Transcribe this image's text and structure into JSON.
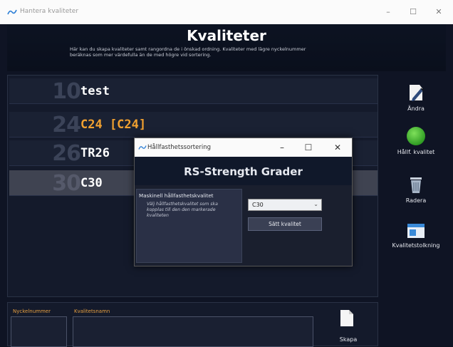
{
  "window": {
    "title": "Hantera kvaliteter",
    "controls": {
      "minimize": "–",
      "maximize": "☐",
      "close": "✕"
    }
  },
  "header": {
    "title": "Kvaliteter",
    "description": "Här kan du skapa kvaliteter samt rangordna de i önskad ordning. Kvaliteter med lägre nyckelnummer beräknas som mer värdefulla än de med högre vid sortering."
  },
  "quality_list": [
    {
      "number": "10",
      "name": "test",
      "color": "#ffffff",
      "selected": false
    },
    {
      "number": "24",
      "name": "C24 [C24]",
      "color": "#f0a030",
      "selected": false
    },
    {
      "number": "26",
      "name": "TR26",
      "color": "#ffffff",
      "selected": false
    },
    {
      "number": "30",
      "name": "C30",
      "color": "#ffffff",
      "selected": true
    }
  ],
  "sidebar": {
    "edit_label": "Ändra",
    "strength_label": "Hållf. kvalitet",
    "delete_label": "Radera",
    "interpretation_label": "Kvalitetstolkning"
  },
  "form": {
    "key_label": "Nyckelnummer",
    "name_label": "Kvalitetsnamn",
    "create_label": "Skapa"
  },
  "dialog": {
    "title": "Hållfasthetssortering",
    "header": "RS-Strength Grader",
    "section_title": "Maskinell hållfasthetskvalitet",
    "section_desc": "Välj hållfasthetskvalitet som ska kopplas till den den markerade kvaliteten",
    "selected_value": "C30",
    "button_label": "Sätt kvalitet",
    "controls": {
      "minimize": "–",
      "maximize": "☐",
      "close": "✕"
    }
  },
  "colors": {
    "accent": "#f0a030",
    "background": "#0f1424"
  }
}
